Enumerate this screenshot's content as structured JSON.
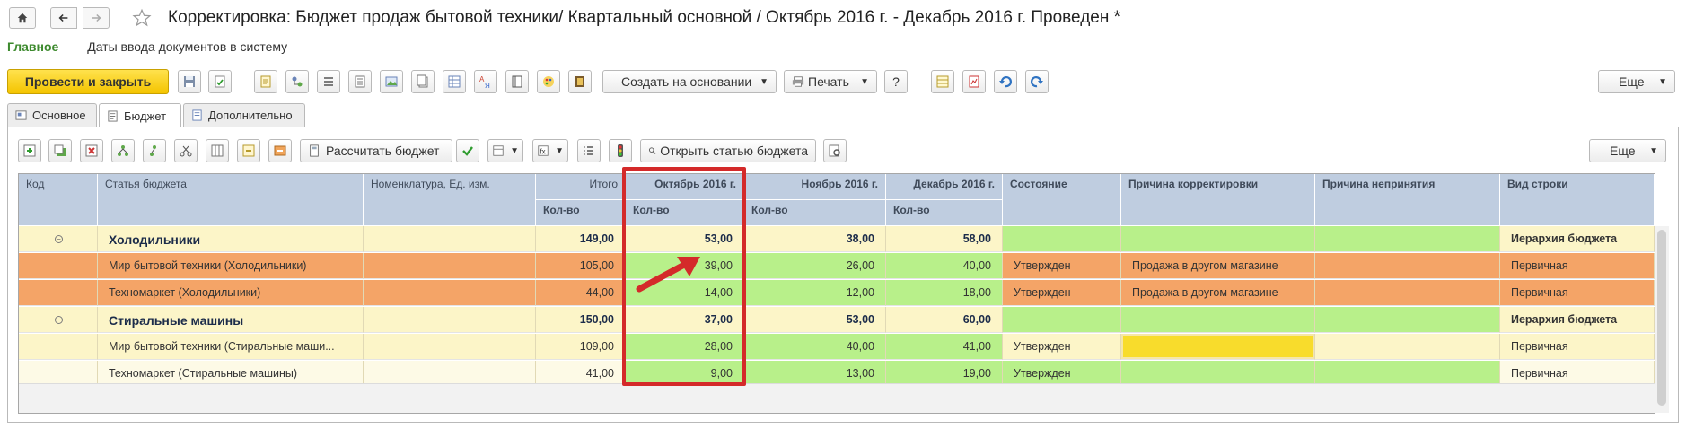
{
  "window": {
    "title": "Корректировка: Бюджет продаж бытовой техники/ Квартальный основной / Октябрь 2016 г. - Декабрь 2016 г. Проведен *"
  },
  "sections": [
    "Главное",
    "Даты ввода документов в систему"
  ],
  "toolbar": {
    "post_and_close": "Провести и закрыть",
    "create_based_on": "Создать на основании",
    "print": "Печать",
    "help": "?",
    "more": "Еще"
  },
  "tabs": [
    "Основное",
    "Бюджет",
    "Дополнительно"
  ],
  "budget_toolbar": {
    "calculate": "Рассчитать бюджет",
    "open_article": "Открыть статью бюджета",
    "more": "Еще"
  },
  "table": {
    "columns": {
      "code": "Код",
      "article": "Статья бюджета",
      "nomenclature": "Номенклатура, Ед. изм.",
      "total": "Итого",
      "oct": "Октябрь 2016 г.",
      "nov": "Ноябрь 2016 г.",
      "dec": "Декабрь 2016 г.",
      "state": "Состояние",
      "reason": "Причина корректировки",
      "reject": "Причина непринятия",
      "row_type": "Вид строки",
      "qty": "Кол-во"
    },
    "rows": [
      {
        "kind": "group",
        "article": "Холодильники",
        "total": "149,00",
        "oct": "53,00",
        "nov": "38,00",
        "dec": "58,00",
        "state": "",
        "reason": "",
        "reject": "",
        "row_type": "Иерархия бюджета"
      },
      {
        "kind": "item-orange",
        "article": "Мир бытовой техники (Холодильники)",
        "total": "105,00",
        "oct": "39,00",
        "nov": "26,00",
        "dec": "40,00",
        "state": "Утвержден",
        "reason": "Продажа в другом магазине",
        "reject": "",
        "row_type": "Первичная"
      },
      {
        "kind": "item-orange",
        "article": "Техномаркет (Холодильники)",
        "total": "44,00",
        "oct": "14,00",
        "nov": "12,00",
        "dec": "18,00",
        "state": "Утвержден",
        "reason": "Продажа в другом магазине",
        "reject": "",
        "row_type": "Первичная"
      },
      {
        "kind": "group",
        "article": "Стиральные машины",
        "total": "150,00",
        "oct": "37,00",
        "nov": "53,00",
        "dec": "60,00",
        "state": "",
        "reason": "",
        "reject": "",
        "row_type": "Иерархия бюджета"
      },
      {
        "kind": "item-yellow",
        "article": "Мир бытовой техники (Стиральные маши...",
        "total": "109,00",
        "oct": "28,00",
        "nov": "40,00",
        "dec": "41,00",
        "state": "Утвержден",
        "reason": "",
        "reject": "",
        "row_type": "Первичная"
      },
      {
        "kind": "item-plain",
        "article": "Техномаркет (Стиральные машины)",
        "total": "41,00",
        "oct": "9,00",
        "nov": "13,00",
        "dec": "19,00",
        "state": "Утвержден",
        "reason": "",
        "reject": "",
        "row_type": "Первичная"
      }
    ]
  },
  "colors": {
    "accent_yellow": "#f4c400",
    "group_row": "#fcf5c8",
    "orange_row": "#f4a467",
    "green_cell": "#b8f08a",
    "header": "#bfcde0",
    "highlight": "#d42a2a"
  }
}
